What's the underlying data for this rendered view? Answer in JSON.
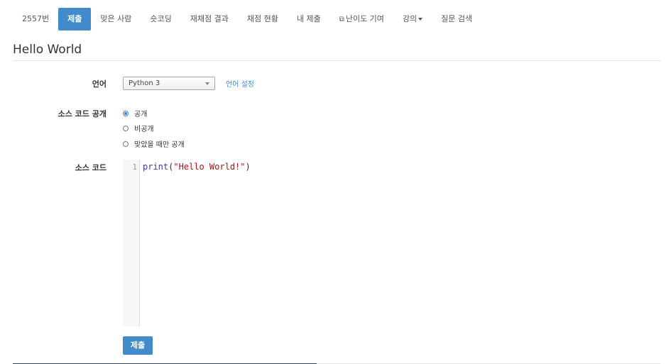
{
  "nav": {
    "tabs": [
      {
        "label": "2557번"
      },
      {
        "label": "제출",
        "active": true
      },
      {
        "label": "맞은 사람"
      },
      {
        "label": "숏코딩"
      },
      {
        "label": "재채점 결과"
      },
      {
        "label": "채점 현황"
      },
      {
        "label": "내 제출"
      },
      {
        "label": "난이도 기여",
        "icon": "external-link-icon"
      },
      {
        "label": "강의",
        "icon": "caret-down-icon"
      },
      {
        "label": "질문 검색"
      }
    ]
  },
  "page": {
    "title": "Hello World"
  },
  "form": {
    "language_label": "언어",
    "language_value": "Python 3",
    "language_settings_link": "언어 설정",
    "visibility_label": "소스 코드 공개",
    "visibility_options": [
      {
        "label": "공개",
        "checked": true
      },
      {
        "label": "비공개",
        "checked": false
      },
      {
        "label": "맞았을 때만 공개",
        "checked": false
      }
    ],
    "source_label": "소스 코드",
    "line_number": "1",
    "code": {
      "fn": "print",
      "open": "(",
      "str": "\"Hello World!\"",
      "close": ")"
    },
    "submit_label": "제출"
  },
  "colors": {
    "accent": "#428bca"
  }
}
